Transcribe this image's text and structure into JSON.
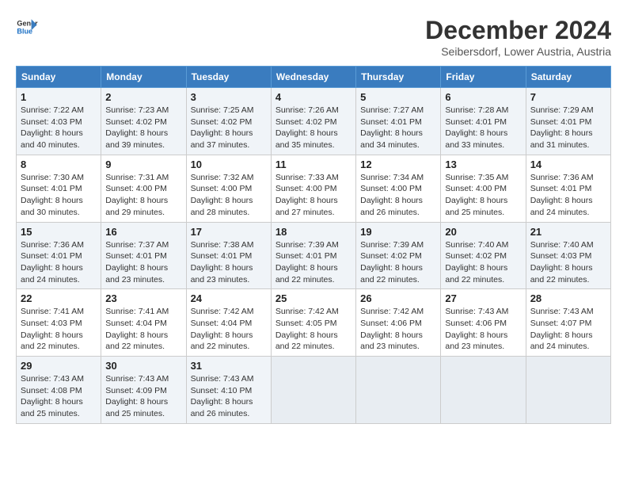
{
  "logo": {
    "line1": "General",
    "line2": "Blue"
  },
  "title": "December 2024",
  "subtitle": "Seibersdorf, Lower Austria, Austria",
  "weekdays": [
    "Sunday",
    "Monday",
    "Tuesday",
    "Wednesday",
    "Thursday",
    "Friday",
    "Saturday"
  ],
  "weeks": [
    [
      {
        "day": "1",
        "sunrise": "Sunrise: 7:22 AM",
        "sunset": "Sunset: 4:03 PM",
        "daylight": "Daylight: 8 hours and 40 minutes."
      },
      {
        "day": "2",
        "sunrise": "Sunrise: 7:23 AM",
        "sunset": "Sunset: 4:02 PM",
        "daylight": "Daylight: 8 hours and 39 minutes."
      },
      {
        "day": "3",
        "sunrise": "Sunrise: 7:25 AM",
        "sunset": "Sunset: 4:02 PM",
        "daylight": "Daylight: 8 hours and 37 minutes."
      },
      {
        "day": "4",
        "sunrise": "Sunrise: 7:26 AM",
        "sunset": "Sunset: 4:02 PM",
        "daylight": "Daylight: 8 hours and 35 minutes."
      },
      {
        "day": "5",
        "sunrise": "Sunrise: 7:27 AM",
        "sunset": "Sunset: 4:01 PM",
        "daylight": "Daylight: 8 hours and 34 minutes."
      },
      {
        "day": "6",
        "sunrise": "Sunrise: 7:28 AM",
        "sunset": "Sunset: 4:01 PM",
        "daylight": "Daylight: 8 hours and 33 minutes."
      },
      {
        "day": "7",
        "sunrise": "Sunrise: 7:29 AM",
        "sunset": "Sunset: 4:01 PM",
        "daylight": "Daylight: 8 hours and 31 minutes."
      }
    ],
    [
      {
        "day": "8",
        "sunrise": "Sunrise: 7:30 AM",
        "sunset": "Sunset: 4:01 PM",
        "daylight": "Daylight: 8 hours and 30 minutes."
      },
      {
        "day": "9",
        "sunrise": "Sunrise: 7:31 AM",
        "sunset": "Sunset: 4:00 PM",
        "daylight": "Daylight: 8 hours and 29 minutes."
      },
      {
        "day": "10",
        "sunrise": "Sunrise: 7:32 AM",
        "sunset": "Sunset: 4:00 PM",
        "daylight": "Daylight: 8 hours and 28 minutes."
      },
      {
        "day": "11",
        "sunrise": "Sunrise: 7:33 AM",
        "sunset": "Sunset: 4:00 PM",
        "daylight": "Daylight: 8 hours and 27 minutes."
      },
      {
        "day": "12",
        "sunrise": "Sunrise: 7:34 AM",
        "sunset": "Sunset: 4:00 PM",
        "daylight": "Daylight: 8 hours and 26 minutes."
      },
      {
        "day": "13",
        "sunrise": "Sunrise: 7:35 AM",
        "sunset": "Sunset: 4:00 PM",
        "daylight": "Daylight: 8 hours and 25 minutes."
      },
      {
        "day": "14",
        "sunrise": "Sunrise: 7:36 AM",
        "sunset": "Sunset: 4:01 PM",
        "daylight": "Daylight: 8 hours and 24 minutes."
      }
    ],
    [
      {
        "day": "15",
        "sunrise": "Sunrise: 7:36 AM",
        "sunset": "Sunset: 4:01 PM",
        "daylight": "Daylight: 8 hours and 24 minutes."
      },
      {
        "day": "16",
        "sunrise": "Sunrise: 7:37 AM",
        "sunset": "Sunset: 4:01 PM",
        "daylight": "Daylight: 8 hours and 23 minutes."
      },
      {
        "day": "17",
        "sunrise": "Sunrise: 7:38 AM",
        "sunset": "Sunset: 4:01 PM",
        "daylight": "Daylight: 8 hours and 23 minutes."
      },
      {
        "day": "18",
        "sunrise": "Sunrise: 7:39 AM",
        "sunset": "Sunset: 4:01 PM",
        "daylight": "Daylight: 8 hours and 22 minutes."
      },
      {
        "day": "19",
        "sunrise": "Sunrise: 7:39 AM",
        "sunset": "Sunset: 4:02 PM",
        "daylight": "Daylight: 8 hours and 22 minutes."
      },
      {
        "day": "20",
        "sunrise": "Sunrise: 7:40 AM",
        "sunset": "Sunset: 4:02 PM",
        "daylight": "Daylight: 8 hours and 22 minutes."
      },
      {
        "day": "21",
        "sunrise": "Sunrise: 7:40 AM",
        "sunset": "Sunset: 4:03 PM",
        "daylight": "Daylight: 8 hours and 22 minutes."
      }
    ],
    [
      {
        "day": "22",
        "sunrise": "Sunrise: 7:41 AM",
        "sunset": "Sunset: 4:03 PM",
        "daylight": "Daylight: 8 hours and 22 minutes."
      },
      {
        "day": "23",
        "sunrise": "Sunrise: 7:41 AM",
        "sunset": "Sunset: 4:04 PM",
        "daylight": "Daylight: 8 hours and 22 minutes."
      },
      {
        "day": "24",
        "sunrise": "Sunrise: 7:42 AM",
        "sunset": "Sunset: 4:04 PM",
        "daylight": "Daylight: 8 hours and 22 minutes."
      },
      {
        "day": "25",
        "sunrise": "Sunrise: 7:42 AM",
        "sunset": "Sunset: 4:05 PM",
        "daylight": "Daylight: 8 hours and 22 minutes."
      },
      {
        "day": "26",
        "sunrise": "Sunrise: 7:42 AM",
        "sunset": "Sunset: 4:06 PM",
        "daylight": "Daylight: 8 hours and 23 minutes."
      },
      {
        "day": "27",
        "sunrise": "Sunrise: 7:43 AM",
        "sunset": "Sunset: 4:06 PM",
        "daylight": "Daylight: 8 hours and 23 minutes."
      },
      {
        "day": "28",
        "sunrise": "Sunrise: 7:43 AM",
        "sunset": "Sunset: 4:07 PM",
        "daylight": "Daylight: 8 hours and 24 minutes."
      }
    ],
    [
      {
        "day": "29",
        "sunrise": "Sunrise: 7:43 AM",
        "sunset": "Sunset: 4:08 PM",
        "daylight": "Daylight: 8 hours and 25 minutes."
      },
      {
        "day": "30",
        "sunrise": "Sunrise: 7:43 AM",
        "sunset": "Sunset: 4:09 PM",
        "daylight": "Daylight: 8 hours and 25 minutes."
      },
      {
        "day": "31",
        "sunrise": "Sunrise: 7:43 AM",
        "sunset": "Sunset: 4:10 PM",
        "daylight": "Daylight: 8 hours and 26 minutes."
      },
      null,
      null,
      null,
      null
    ]
  ]
}
